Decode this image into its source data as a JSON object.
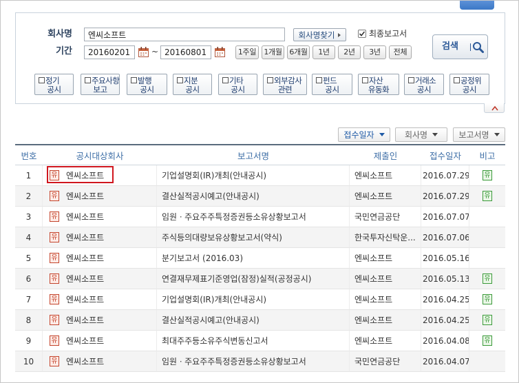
{
  "search": {
    "company_label": "회사명",
    "company_value": "엔씨소프트",
    "find_company_button": "회사명찾기",
    "final_report": {
      "label": "최종보고서",
      "checked": true
    },
    "period_label": "기간",
    "start_date": "20160201",
    "period_separator": "~",
    "end_date": "20160801",
    "period_buttons": [
      "1주일",
      "1개월",
      "6개월",
      "1년",
      "2년",
      "3년",
      "전체"
    ],
    "search_button": "검색",
    "categories": [
      {
        "line1": "정기",
        "line2": "공시"
      },
      {
        "line1": "주요사항",
        "line2": "보고"
      },
      {
        "line1": "발행",
        "line2": "공시"
      },
      {
        "line1": "지분",
        "line2": "공시"
      },
      {
        "line1": "기타",
        "line2": "공시"
      },
      {
        "line1": "외부감사",
        "line2": "관련"
      },
      {
        "line1": "펀드",
        "line2": "공시"
      },
      {
        "line1": "자산",
        "line2": "유동화"
      },
      {
        "line1": "거래소",
        "line2": "공시"
      },
      {
        "line1": "공정위",
        "line2": "공시"
      }
    ]
  },
  "sort_buttons": [
    {
      "label": "접수일자",
      "active": true
    },
    {
      "label": "회사명",
      "active": false
    },
    {
      "label": "보고서명",
      "active": false
    }
  ],
  "table": {
    "headers": [
      "번호",
      "공시대상회사",
      "보고서명",
      "제출인",
      "접수일자",
      "비고"
    ],
    "rows": [
      {
        "no": "1",
        "market": "유",
        "company": "엔씨소프트",
        "report": "기업설명회(IR)개최(안내공시)",
        "submitter": "엔씨소프트",
        "date": "2016.07.29",
        "note": "유"
      },
      {
        "no": "2",
        "market": "유",
        "company": "엔씨소프트",
        "report": "결산실적공시예고(안내공시)",
        "submitter": "엔씨소프트",
        "date": "2016.07.29",
        "note": "유"
      },
      {
        "no": "3",
        "market": "유",
        "company": "엔씨소프트",
        "report": "임원ㆍ주요주주특정증권등소유상황보고서",
        "submitter": "국민연금공단",
        "date": "2016.07.07",
        "note": ""
      },
      {
        "no": "4",
        "market": "유",
        "company": "엔씨소프트",
        "report": "주식등의대량보유상황보고서(약식)",
        "submitter": "한국투자신탁운...",
        "date": "2016.07.06",
        "note": ""
      },
      {
        "no": "5",
        "market": "유",
        "company": "엔씨소프트",
        "report": "분기보고서 (2016.03)",
        "submitter": "엔씨소프트",
        "date": "2016.05.16",
        "note": ""
      },
      {
        "no": "6",
        "market": "유",
        "company": "엔씨소프트",
        "report": "연결재무제표기준영업(잠정)실적(공정공시)",
        "submitter": "엔씨소프트",
        "date": "2016.05.13",
        "note": "유"
      },
      {
        "no": "7",
        "market": "유",
        "company": "엔씨소프트",
        "report": "기업설명회(IR)개최(안내공시)",
        "submitter": "엔씨소프트",
        "date": "2016.04.25",
        "note": "유"
      },
      {
        "no": "8",
        "market": "유",
        "company": "엔씨소프트",
        "report": "결산실적공시예고(안내공시)",
        "submitter": "엔씨소프트",
        "date": "2016.04.25",
        "note": "유"
      },
      {
        "no": "9",
        "market": "유",
        "company": "엔씨소프트",
        "report": "최대주주등소유주식변동신고서",
        "submitter": "엔씨소프트",
        "date": "2016.04.08",
        "note": "유"
      },
      {
        "no": "10",
        "market": "유",
        "company": "엔씨소프트",
        "report": "임원ㆍ주요주주특정증권등소유상황보고서",
        "submitter": "국민연금공단",
        "date": "2016.04.07",
        "note": ""
      }
    ]
  },
  "colors": {
    "accent_blue": "#1f5aa6",
    "header_text": "#3d6ea6",
    "label_text": "#2f4460",
    "highlight_red": "#d0161e",
    "market_badge": "#c4442c",
    "note_badge": "#3a9a39",
    "alt_row_bg": "#f4f4f4",
    "top_tab": "#3b78c6"
  },
  "icons": {
    "find_company_arrow": "caret-right-icon",
    "calendar": "calendar-icon",
    "search": "search-icon",
    "sort": "caret-down-icon",
    "collapse": "chevron-up-icon",
    "checkbox": "checkbox-icon"
  }
}
